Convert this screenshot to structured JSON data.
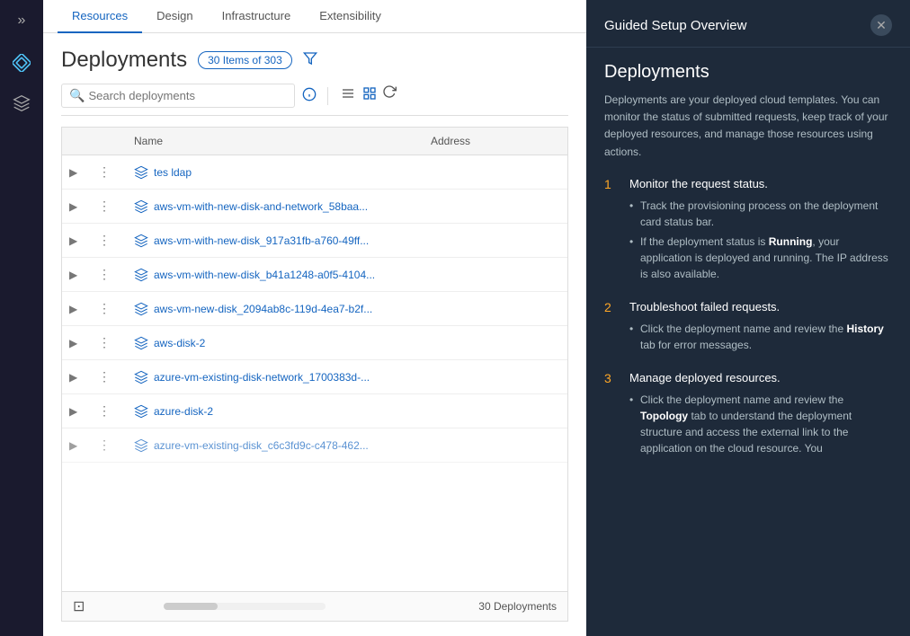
{
  "nav": {
    "tabs": [
      {
        "label": "Resources",
        "active": true
      },
      {
        "label": "Design",
        "active": false
      },
      {
        "label": "Infrastructure",
        "active": false
      },
      {
        "label": "Extensibility",
        "active": false
      }
    ]
  },
  "sidebar": {
    "toggle": "»",
    "icons": [
      {
        "name": "diamond-icon",
        "glyph": "◈",
        "active": true
      },
      {
        "name": "cube-icon",
        "glyph": "⬡",
        "active": false
      }
    ]
  },
  "page": {
    "title": "Deployments",
    "items_badge": "30 Items of 303",
    "search_placeholder": "Search deployments",
    "columns": [
      {
        "label": "",
        "key": "expand"
      },
      {
        "label": "",
        "key": "menu"
      },
      {
        "label": "Name",
        "key": "name"
      },
      {
        "label": "Address",
        "key": "address"
      }
    ],
    "rows": [
      {
        "id": 1,
        "name": "tes ldap",
        "address": ""
      },
      {
        "id": 2,
        "name": "aws-vm-with-new-disk-and-network_58baa...",
        "address": ""
      },
      {
        "id": 3,
        "name": "aws-vm-with-new-disk_917a31fb-a760-49ff...",
        "address": ""
      },
      {
        "id": 4,
        "name": "aws-vm-with-new-disk_b41a1248-a0f5-4104...",
        "address": ""
      },
      {
        "id": 5,
        "name": "aws-vm-new-disk_2094ab8c-119d-4ea7-b2f...",
        "address": ""
      },
      {
        "id": 6,
        "name": "aws-disk-2",
        "address": ""
      },
      {
        "id": 7,
        "name": "azure-vm-existing-disk-network_1700383d-...",
        "address": ""
      },
      {
        "id": 8,
        "name": "azure-disk-2",
        "address": ""
      },
      {
        "id": 9,
        "name": "azure-vm-existing-disk_c6c3fd9c-c478-462...",
        "address": ""
      }
    ],
    "footer_count": "30 Deployments"
  },
  "guided_panel": {
    "header_title": "Guided Setup Overview",
    "section_title": "Deployments",
    "description": "Deployments are your deployed cloud templates. You can monitor the status of submitted requests, keep track of your deployed resources, and manage those resources using actions.",
    "steps": [
      {
        "number": "1",
        "heading": "Monitor the request status.",
        "bullets": [
          "Track the provisioning process on the deployment card status bar.",
          "If the deployment status is Running, your application is deployed and running. The IP address is also available."
        ]
      },
      {
        "number": "2",
        "heading": "Troubleshoot failed requests.",
        "bullets": [
          "Click the deployment name and review the History tab for error messages."
        ],
        "bold_words": [
          "History"
        ]
      },
      {
        "number": "3",
        "heading": "Manage deployed resources.",
        "bullets": [
          "Click the deployment name and review the Topology tab to understand the deployment structure and access the external link to the application on the cloud resource. You"
        ],
        "bold_words": [
          "Topology"
        ]
      }
    ]
  }
}
